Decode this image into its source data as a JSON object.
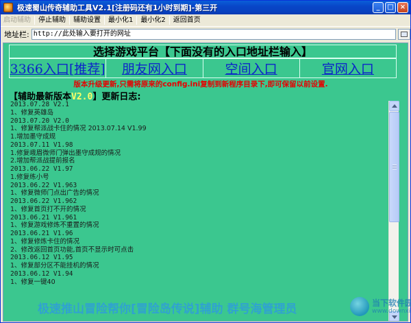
{
  "window": {
    "title": "极速蜀山传奇辅助工具V2.1[注册码还有1小时到期]-第三开",
    "minimize": "_",
    "maximize": "□",
    "close": "×"
  },
  "menu": {
    "items": [
      {
        "label": "启动辅助",
        "disabled": true
      },
      {
        "label": "停止辅助",
        "disabled": false
      },
      {
        "label": "辅助设置",
        "disabled": false
      },
      {
        "label": "最小化1",
        "disabled": false
      },
      {
        "label": "最小化2",
        "disabled": false
      },
      {
        "label": "返回首页",
        "disabled": false
      }
    ]
  },
  "address": {
    "label": "地址栏:",
    "value": "http://此处输入要打开的网址"
  },
  "content": {
    "header": "选择游戏平台【下面没有的入口地址栏输入】",
    "links": [
      "3366入口[推荐]",
      "朋友网入口",
      "空间入口",
      "官网入口"
    ],
    "notice": "版本升级更新,只需将原来的config.ini复制到新程序目录下,即可保留以前设置.",
    "version_prefix": "【辅助最新版本",
    "version": "V2.0",
    "version_suffix": "】更新日志:",
    "log": [
      {
        "text": "2013.07.28 V2.1",
        "date": true
      },
      {
        "text": "1、修复英雄岛",
        "date": false
      },
      {
        "text": "2013.07.20 V2.0",
        "date": true
      },
      {
        "text": "1、修复帮派战卡住的情况 2013.07.14 V1.99",
        "date": false
      },
      {
        "text": "1.增加墨守成规",
        "date": false
      },
      {
        "text": "2013.07.11 V1.98",
        "date": true
      },
      {
        "text": "1.修复峨眉微师门弹出墨守成规的情况",
        "date": false
      },
      {
        "text": "2.增加帮派战提前报名",
        "date": false
      },
      {
        "text": "2013.06.22 V1.97",
        "date": true
      },
      {
        "text": "1.修复练小号",
        "date": false
      },
      {
        "text": "2013.06.22 V1.963",
        "date": true
      },
      {
        "text": "1、修复微师门点出广告的情况",
        "date": false
      },
      {
        "text": "2013.06.22 V1.962",
        "date": true
      },
      {
        "text": "1、修复首页打不开的情况",
        "date": false
      },
      {
        "text": "2013.06.21 V1.961",
        "date": true
      },
      {
        "text": "1、修复游戏修炼不重置的情况",
        "date": false
      },
      {
        "text": "2013.06.21 V1.96",
        "date": true
      },
      {
        "text": "1、修复修炼卡住的情况",
        "date": false
      },
      {
        "text": "2、修改返回首页功能,首页不显示时可点击",
        "date": false
      },
      {
        "text": "2013.06.12 V1.95",
        "date": true
      },
      {
        "text": "1、修复部分区不能挂机的情况",
        "date": false
      },
      {
        "text": "2013.06.12 V1.94",
        "date": true
      },
      {
        "text": "1、修复一键40",
        "date": false
      }
    ],
    "footer_banner": "极速推山冒险帮你[冒险岛传说]辅助 群号海管理员"
  },
  "watermark": {
    "line1": "当下软件园",
    "line2": "www.downxia.com"
  },
  "colors": {
    "content_bg": "#3bc78f",
    "link": "#0c24c9",
    "notice": "#e60000",
    "version": "#ffff66"
  }
}
